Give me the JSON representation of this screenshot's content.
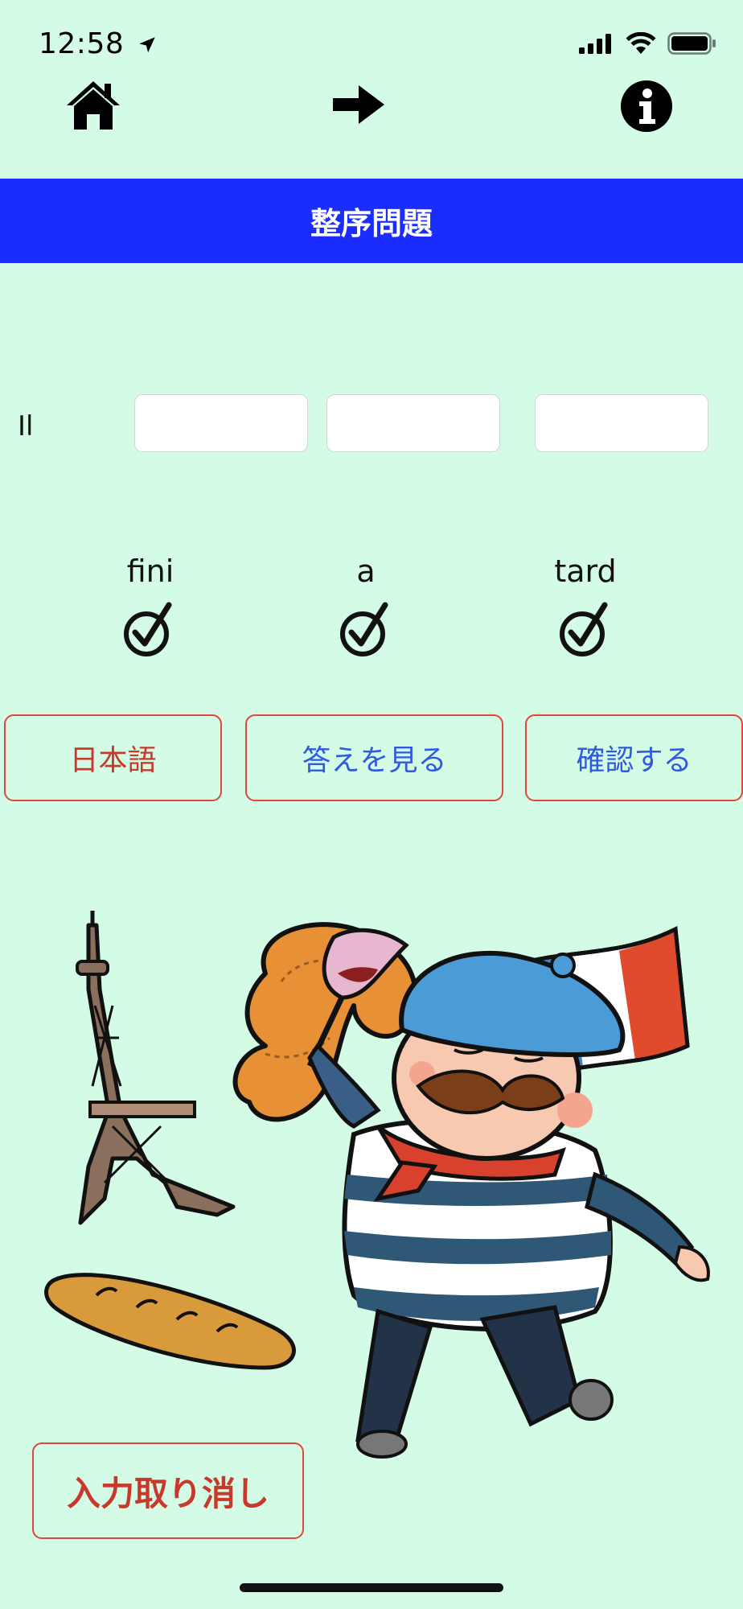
{
  "status_bar": {
    "time": "12:58",
    "icons": [
      "location-arrow-icon",
      "cellular-signal-icon",
      "wifi-icon",
      "battery-icon"
    ]
  },
  "nav": {
    "icons": [
      "home-icon",
      "arrow-right-icon",
      "info-icon"
    ]
  },
  "header": {
    "title": "整序問題"
  },
  "sentence": {
    "prefix": "Il",
    "slot_count": 3
  },
  "words": [
    {
      "text": "fini",
      "checked": true
    },
    {
      "text": "a",
      "checked": true
    },
    {
      "text": "tard",
      "checked": true
    }
  ],
  "buttons": {
    "japanese": "日本語",
    "show_answer": "答えを見る",
    "check": "確認する",
    "undo": "入力取り消し"
  },
  "colors": {
    "background": "#d4fbe6",
    "header": "#1b2cff",
    "button_border": "#e0463a",
    "red_text": "#c9392b",
    "blue_text": "#2f5ae0"
  },
  "illustration_icons": [
    "eiffel-tower-icon",
    "croissant-icon",
    "french-flag-icon",
    "baguette-icon",
    "french-man-illustration"
  ]
}
